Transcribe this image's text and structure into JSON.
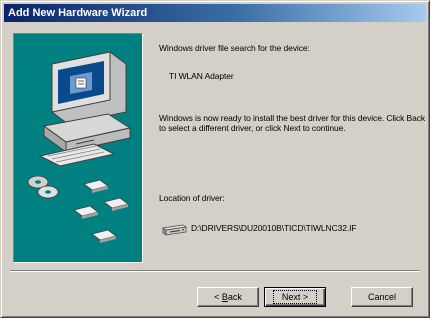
{
  "window": {
    "title": "Add New Hardware Wizard"
  },
  "content": {
    "search_heading": "Windows driver file search for the device:",
    "device_name": "TI WLAN Adapter",
    "ready_message": "Windows is now ready to install the best driver for this device. Click Back to select a different driver, or click Next to continue.",
    "location_label": "Location of driver:",
    "driver_path": "D:\\DRIVERS\\DU20010B\\TICD\\TIWLNC32.IF"
  },
  "buttons": {
    "back_prefix": "< ",
    "back_hotkey": "B",
    "back_rest": "ack",
    "next_label": "Next >",
    "cancel_label": "Cancel"
  },
  "icons": {
    "picture": "computer-with-disks-illustration",
    "drive": "drive-icon"
  },
  "colors": {
    "title_bar": "#0a246a",
    "picture_background": "#008080",
    "dialog_face": "#d4d0c8"
  }
}
